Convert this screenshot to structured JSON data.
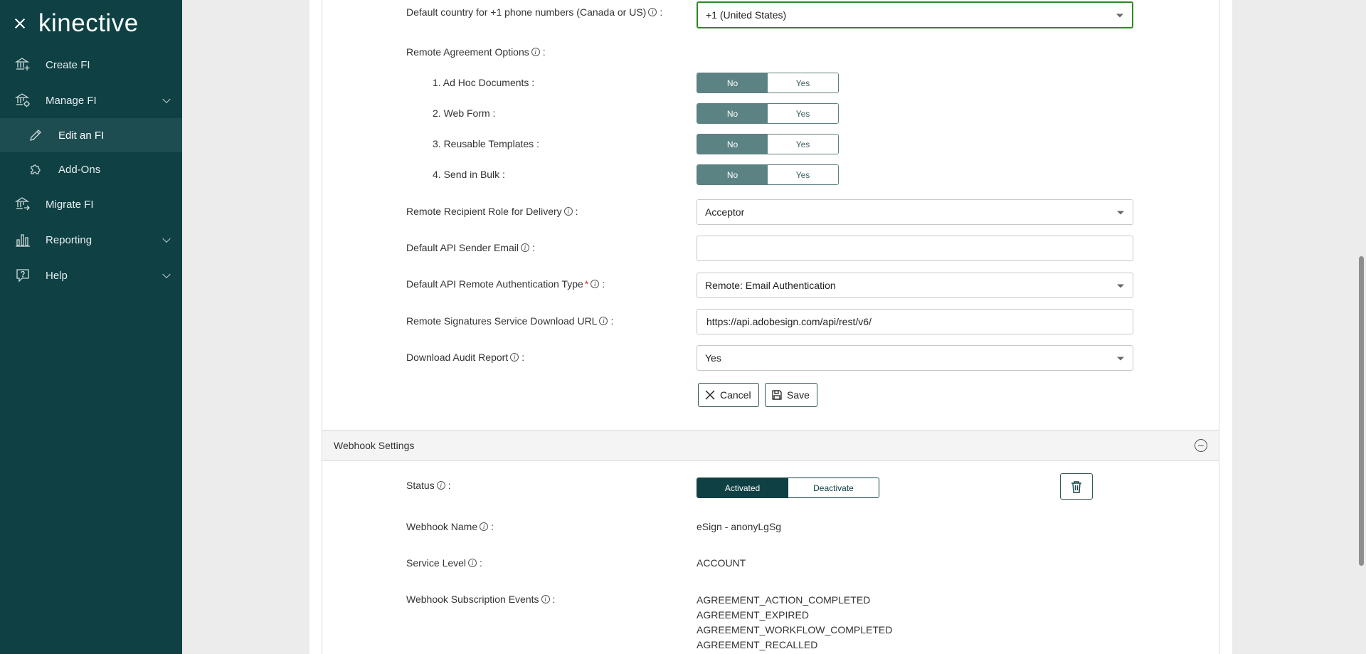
{
  "sidebar": {
    "logo": "kinective",
    "items": [
      {
        "label": "Create FI",
        "icon": "bank-plus-icon"
      },
      {
        "label": "Manage FI",
        "icon": "bank-gear-icon"
      },
      {
        "label": "Edit an FI",
        "icon": "pencil-icon"
      },
      {
        "label": "Add-Ons",
        "icon": "puzzle-icon"
      },
      {
        "label": "Migrate FI",
        "icon": "bank-arrow-icon"
      },
      {
        "label": "Reporting",
        "icon": "bar-chart-icon"
      },
      {
        "label": "Help",
        "icon": "help-bubble-icon"
      }
    ]
  },
  "form": {
    "default_country": {
      "label": "Default country for +1 phone numbers (Canada or US)",
      "value": "+1 (United States)"
    },
    "remote_agreement": {
      "label": "Remote Agreement Options"
    },
    "options": [
      {
        "label": "1. Ad Hoc Documents :",
        "no": "No",
        "yes": "Yes",
        "selected": "No"
      },
      {
        "label": "2. Web Form :",
        "no": "No",
        "yes": "Yes",
        "selected": "No"
      },
      {
        "label": "3. Reusable Templates :",
        "no": "No",
        "yes": "Yes",
        "selected": "No"
      },
      {
        "label": "4. Send in Bulk :",
        "no": "No",
        "yes": "Yes",
        "selected": "No"
      }
    ],
    "recipient_role": {
      "label": "Remote Recipient Role for Delivery",
      "value": "Acceptor"
    },
    "api_sender_email": {
      "label": "Default API Sender Email",
      "value": ""
    },
    "api_auth_type": {
      "label": "Default API Remote Authentication Type",
      "required": "*",
      "value": "Remote: Email Authentication"
    },
    "download_url": {
      "label": "Remote Signatures Service Download URL",
      "value": "https://api.adobesign.com/api/rest/v6/"
    },
    "audit_report": {
      "label": "Download Audit Report",
      "value": "Yes"
    },
    "cancel_label": "Cancel",
    "save_label": "Save"
  },
  "webhook": {
    "section_title": "Webhook Settings",
    "status": {
      "label": "Status",
      "activated": "Activated",
      "deactivate": "Deactivate",
      "selected": "Activated"
    },
    "name": {
      "label": "Webhook Name",
      "value": "eSign - anonyLgSg"
    },
    "service_level": {
      "label": "Service Level",
      "value": "ACCOUNT"
    },
    "events": {
      "label": "Webhook Subscription Events",
      "values": [
        "AGREEMENT_ACTION_COMPLETED",
        "AGREEMENT_EXPIRED",
        "AGREEMENT_WORKFLOW_COMPLETED",
        "AGREEMENT_RECALLED"
      ]
    }
  },
  "common": {
    "colon": ":",
    "info_glyph": "i"
  }
}
